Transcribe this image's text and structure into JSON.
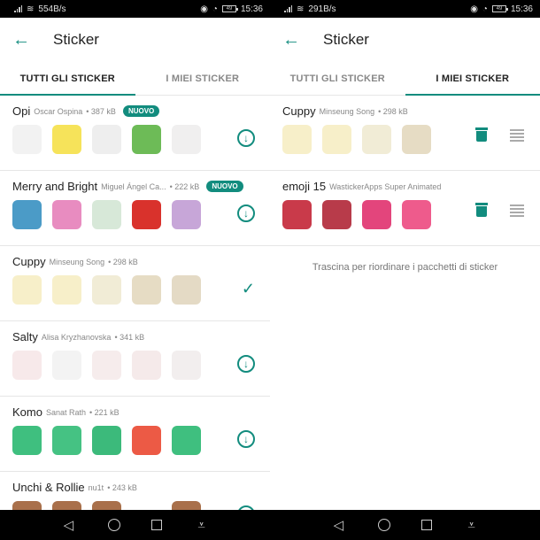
{
  "accent_color": "#128c7e",
  "screens": [
    {
      "status": {
        "net_speed": "554B/s",
        "battery": "49",
        "time": "15:36"
      },
      "title": "Sticker",
      "tabs": [
        {
          "label": "TUTTI GLI STICKER",
          "active": true
        },
        {
          "label": "I MIEI STICKER",
          "active": false
        }
      ],
      "packs": [
        {
          "name": "Opi",
          "author": "Oscar Ospina",
          "size": "• 387 kB",
          "badge": "NUOVO",
          "action": "download",
          "stickers": [
            "#f2f2f2",
            "#f6e35a",
            "#eeeeee",
            "#6dbb57",
            "#f0efef"
          ]
        },
        {
          "name": "Merry and Bright",
          "author": "Miguel Ángel Ca...",
          "size": "• 222 kB",
          "badge": "NUOVO",
          "action": "download",
          "stickers": [
            "#4b9bc7",
            "#e88cc0",
            "#d7e8d8",
            "#d9322c",
            "#c7a6d8"
          ]
        },
        {
          "name": "Cuppy",
          "author": "Minseung Song",
          "size": "• 298 kB",
          "badge": "",
          "action": "installed",
          "stickers": [
            "#f7efc9",
            "#f7efc9",
            "#f1ecd6",
            "#e6dcc4",
            "#e4dac5"
          ]
        },
        {
          "name": "Salty",
          "author": "Alisa Kryzhanovska",
          "size": "• 341 kB",
          "badge": "",
          "action": "download",
          "stickers": [
            "#f7e9ea",
            "#f3f3f3",
            "#f6ecec",
            "#f5eaea",
            "#f2eeee"
          ]
        },
        {
          "name": "Komo",
          "author": "Sanat Rath",
          "size": "• 221 kB",
          "badge": "",
          "action": "download",
          "stickers": [
            "#3fbf7f",
            "#45c283",
            "#3cba7b",
            "#ec5a45",
            "#3fbf7f"
          ]
        },
        {
          "name": "Unchi & Rollie",
          "author": "nu1t",
          "size": "• 243 kB",
          "badge": "",
          "action": "download",
          "stickers": [
            "#a9704b",
            "#a9704b",
            "#a9704b",
            "#ffffff",
            "#a9704b"
          ]
        }
      ],
      "download_glyph": "↓",
      "check_glyph": "✓"
    },
    {
      "status": {
        "net_speed": "291B/s",
        "battery": "49",
        "time": "15:36"
      },
      "title": "Sticker",
      "tabs": [
        {
          "label": "TUTTI GLI STICKER",
          "active": false
        },
        {
          "label": "I MIEI STICKER",
          "active": true
        }
      ],
      "packs": [
        {
          "name": "Cuppy",
          "author": "Minseung Song",
          "size": "• 298 kB",
          "stickers": [
            "#f7efc9",
            "#f7efc9",
            "#f1ecd6",
            "#e6dcc4"
          ]
        },
        {
          "name": "emoji 15",
          "author": "WastickerApps Super Animated",
          "size": "",
          "stickers": [
            "#c93a4a",
            "#b83b4a",
            "#e3457c",
            "#ee5b8c"
          ]
        }
      ],
      "hint": "Trascina per riordinare i pacchetti di sticker"
    }
  ],
  "nav": {
    "back": "◁",
    "home": "○",
    "recents": "□",
    "notifications": "⩡"
  },
  "icons": {
    "back_arrow": "←",
    "wifi": "≋"
  }
}
